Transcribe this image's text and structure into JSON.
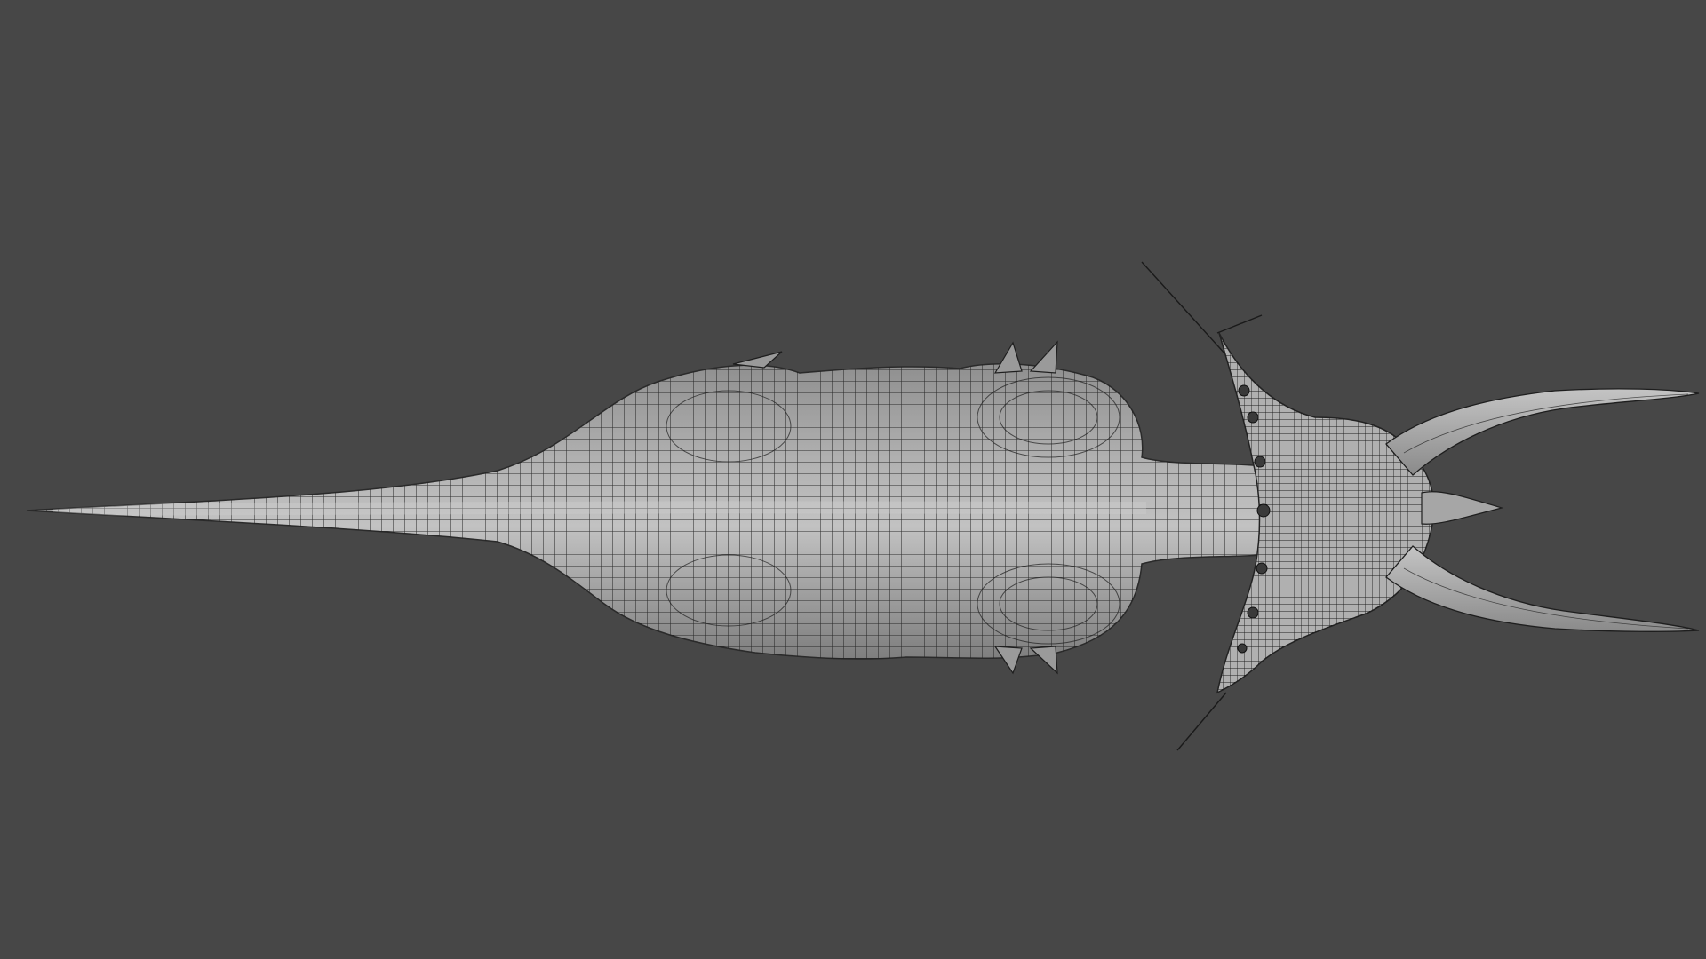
{
  "viewport": {
    "background_color": "#474747",
    "mesh_fill_color": "#a9a9a9",
    "wire_color": "#1e1e1e",
    "label": ""
  },
  "model": {
    "parts": [
      "tail",
      "body",
      "dorsal-spikes",
      "neck",
      "head-frill",
      "horns",
      "snout-spike",
      "whiskers"
    ]
  }
}
